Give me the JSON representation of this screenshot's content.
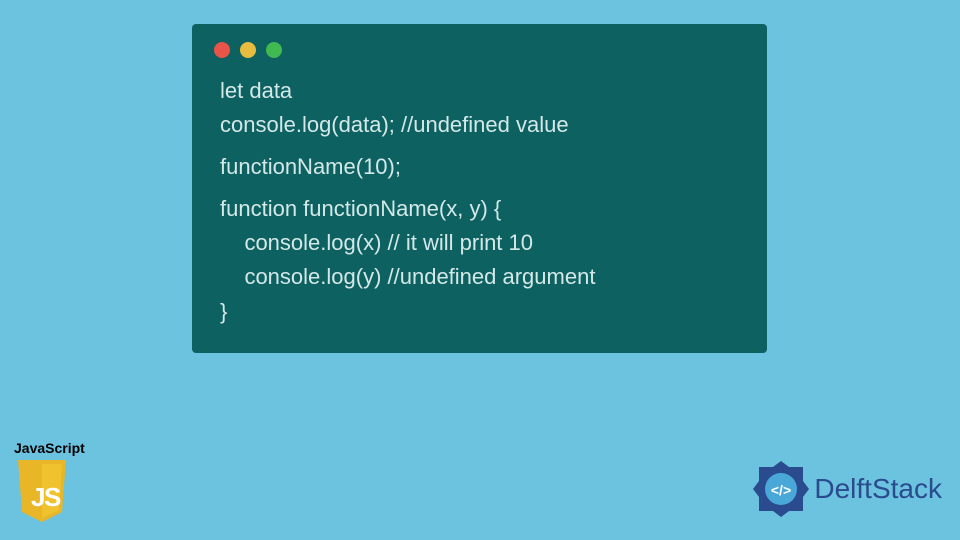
{
  "code": {
    "line1": "let data",
    "line2": "console.log(data); //undefined value",
    "line3": "functionName(10);",
    "line4": "function functionName(x, y) {",
    "line5": "    console.log(x) // it will print 10",
    "line6": "    console.log(y) //undefined argument",
    "line7": "}"
  },
  "jsLogo": {
    "label": "JavaScript",
    "letters": "JS"
  },
  "delft": {
    "text": "DelftStack",
    "badgeSymbol": "</>"
  },
  "colors": {
    "background": "#6cc3e0",
    "codeWindow": "#0d6161",
    "codeText": "#d4e8e8",
    "dotRed": "#e85448",
    "dotYellow": "#e8bd3f",
    "dotGreen": "#3fb950",
    "jsYellow": "#f0c22e",
    "delftBlue": "#2a4b8d"
  }
}
